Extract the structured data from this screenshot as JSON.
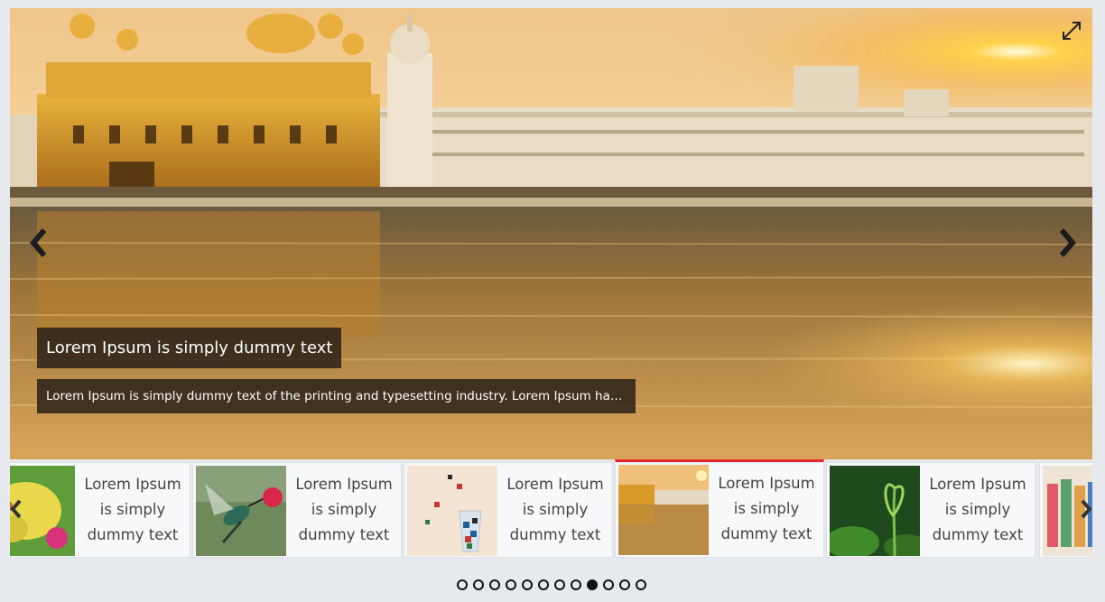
{
  "slider": {
    "current_slide": 9,
    "caption_title": "Lorem Ipsum is simply dummy text",
    "caption_description": "Lorem Ipsum is simply dummy text of the printing and typesetting industry. Lorem Ipsum has...",
    "icons": {
      "prev": "chevron-left-icon",
      "next": "chevron-right-icon",
      "fullscreen": "expand-icon"
    }
  },
  "thumbnails": [
    {
      "label": "Lorem Ipsum is simply dummy text",
      "image": "butterfly"
    },
    {
      "label": "Lorem Ipsum is simply dummy text",
      "image": "hummingbird"
    },
    {
      "label": "Lorem Ipsum is simply dummy text",
      "image": "dice-glass"
    },
    {
      "label": "Lorem Ipsum is simply dummy text",
      "image": "golden-temple",
      "active": true
    },
    {
      "label": "Lorem Ipsum is simply dummy text",
      "image": "plant-sprout"
    },
    {
      "label": "",
      "image": "colorful-bottles"
    }
  ],
  "pagination": {
    "total": 12,
    "active_index": 8
  },
  "colors": {
    "accent": "#e8232a",
    "background": "#e6eaee",
    "caption_bg": "#231c16"
  }
}
